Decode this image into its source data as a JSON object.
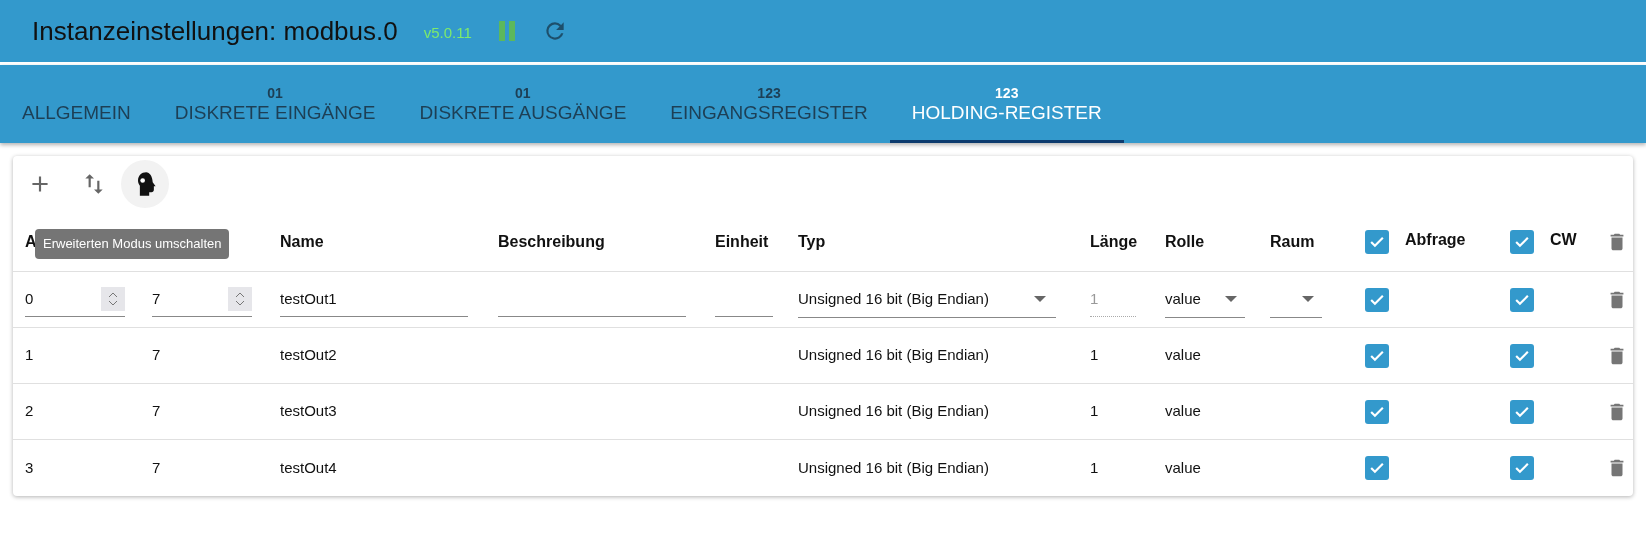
{
  "header": {
    "title": "Instanzeinstellungen: modbus.0",
    "version": "v5.0.11",
    "running": true
  },
  "tabs": [
    {
      "label": "ALLGEMEIN",
      "selected": false
    },
    {
      "badge": "01",
      "label": "DISKRETE EINGÄNGE",
      "selected": false
    },
    {
      "badge": "01",
      "label": "DISKRETE AUSGÄNGE",
      "selected": false
    },
    {
      "badge": "123",
      "label": "EINGANGSREGISTER",
      "selected": false
    },
    {
      "badge": "123",
      "label": "HOLDING-REGISTER",
      "selected": true
    }
  ],
  "toolbar": {
    "expert_mode": true,
    "tooltip": "Erweiterten Modus umschalten"
  },
  "table": {
    "columns": [
      "A",
      "",
      "Name",
      "Beschreibung",
      "Einheit",
      "Typ",
      "Länge",
      "Rolle",
      "Raum"
    ],
    "header_checks": [
      {
        "checked": true,
        "label": "Abfrage"
      },
      {
        "checked": true,
        "label": "CW"
      }
    ],
    "rows": [
      {
        "kind": "edit",
        "address": "0",
        "slave_id": "7",
        "name": "testOut1",
        "description": "",
        "unit": "",
        "type": "Unsigned 16 bit (Big Endian)",
        "length": "1",
        "role": "value",
        "room": "",
        "poll": true,
        "cw": true
      },
      {
        "kind": "plain",
        "address": "1",
        "slave_id": "7",
        "name": "testOut2",
        "type": "Unsigned 16 bit (Big Endian)",
        "length": "1",
        "role": "value",
        "poll": true,
        "cw": true
      },
      {
        "kind": "plain",
        "address": "2",
        "slave_id": "7",
        "name": "testOut3",
        "type": "Unsigned 16 bit (Big Endian)",
        "length": "1",
        "role": "value",
        "poll": true,
        "cw": true
      },
      {
        "kind": "plain",
        "address": "3",
        "slave_id": "7",
        "name": "testOut4",
        "type": "Unsigned 16 bit (Big Endian)",
        "length": "1",
        "role": "value",
        "poll": true,
        "cw": true
      }
    ]
  }
}
